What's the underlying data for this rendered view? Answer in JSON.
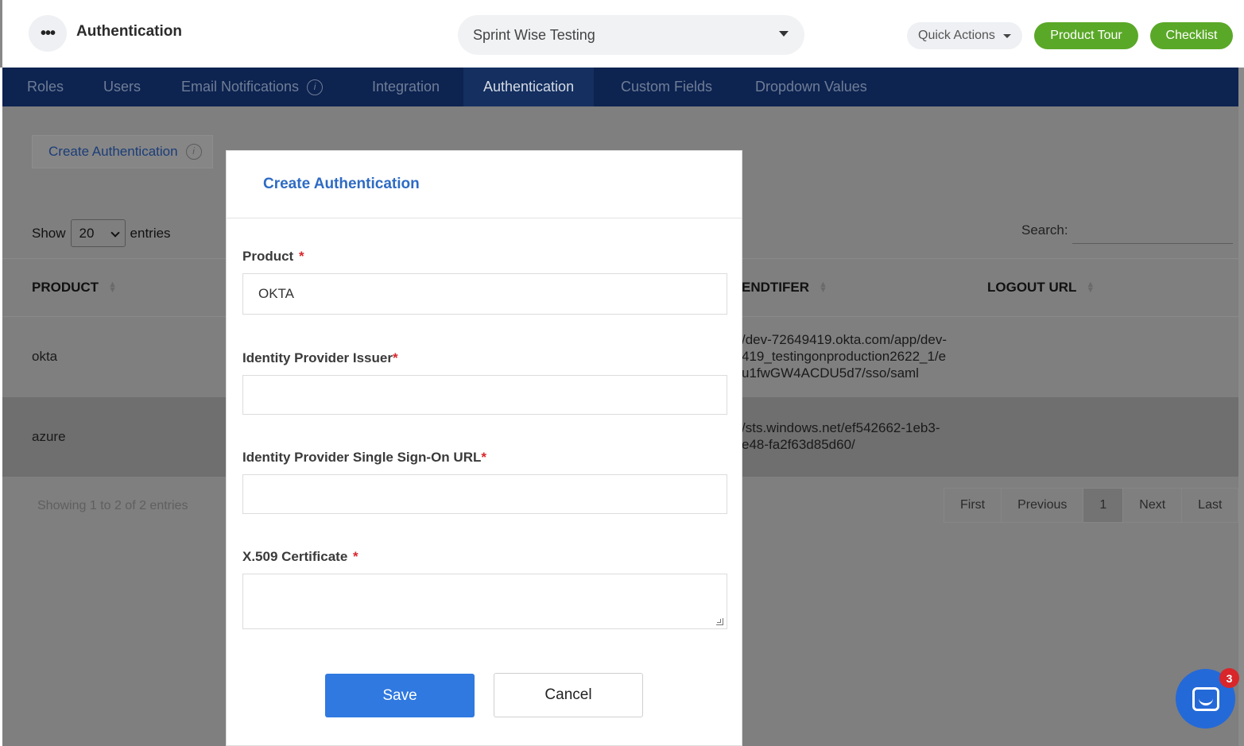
{
  "header": {
    "title": "Authentication",
    "project": "Sprint Wise Testing",
    "quick_actions": "Quick Actions",
    "product_tour": "Product Tour",
    "checklist": "Checklist"
  },
  "nav": {
    "items": [
      {
        "label": "Roles"
      },
      {
        "label": "Users"
      },
      {
        "label": "Email Notifications"
      },
      {
        "label": "Integration"
      },
      {
        "label": "Authentication"
      },
      {
        "label": "Custom Fields"
      },
      {
        "label": "Dropdown Values"
      }
    ],
    "active": "Authentication"
  },
  "page": {
    "create_button": "Create Authentication",
    "show_label": "Show",
    "entries_value": "20",
    "entries_label": "entries",
    "search_label": "Search:",
    "columns": {
      "product": "PRODUCT",
      "identifier": "ENDTIFER",
      "logout": "LOGOUT URL"
    },
    "rows": [
      {
        "product": "okta",
        "url_lines": [
          "/dev-72649419.okta.com/app/dev-",
          "419_testingonproduction2622_1/e",
          "u1fwGW4ACDU5d7/sso/saml"
        ]
      },
      {
        "product": "azure",
        "url_lines": [
          "/sts.windows.net/ef542662-1eb3-",
          "e48-fa2f63d85d60/"
        ]
      }
    ],
    "showing": "Showing 1 to 2 of 2 entries",
    "pager": {
      "first": "First",
      "previous": "Previous",
      "current": "1",
      "next": "Next",
      "last": "Last"
    }
  },
  "modal": {
    "title": "Create Authentication",
    "product_label": "Product",
    "product_value": "OKTA",
    "issuer_label": "Identity Provider Issuer",
    "sso_label": "Identity Provider Single Sign-On URL",
    "cert_label": "X.509 Certificate",
    "required_mark": "*",
    "save": "Save",
    "cancel": "Cancel"
  },
  "chat": {
    "badge": "3"
  },
  "colors": {
    "nav_bg": "#0d2350",
    "green": "#5aa828",
    "primary": "#2f79e0",
    "modal_title": "#2e6bc4",
    "required": "#d8262b"
  }
}
